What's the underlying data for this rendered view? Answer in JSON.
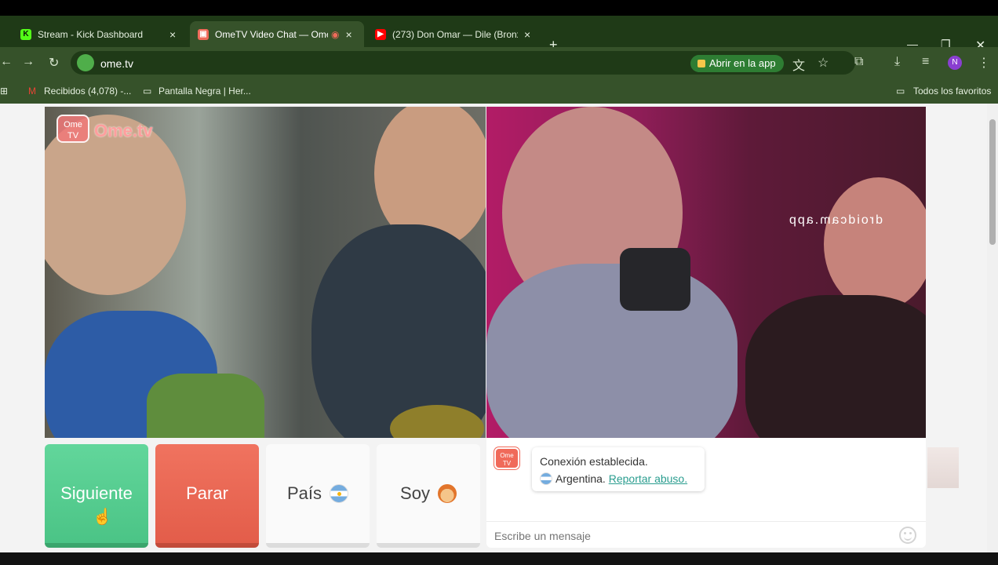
{
  "tabs": [
    {
      "label": "Stream - Kick Dashboard",
      "icon": "kick-icon",
      "active": false
    },
    {
      "label": "OmeTV Video Chat — Ome",
      "icon": "ometv-icon",
      "active": true
    },
    {
      "label": "(273) Don Omar — Dile (Bronx",
      "icon": "youtube-icon",
      "active": false
    }
  ],
  "toolbar": {
    "url": "ome.tv",
    "open_app_label": "Abrir en la app"
  },
  "bookmarks": {
    "items": [
      "Recibidos (4,078) -...",
      "Pantalla Negra | Her..."
    ],
    "all_favorites": "Todos los favoritos"
  },
  "video": {
    "left_watermark": "Ome.tv",
    "watermark_badge": "Ome TV",
    "right_overlay_text": "droidcam.app"
  },
  "controls": {
    "next_label": "Siguiente",
    "stop_label": "Parar",
    "country_label": "País",
    "me_label": "Soy"
  },
  "chat": {
    "logo_text": "Ome TV",
    "status": "Conexión establecida.",
    "country": "Argentina.",
    "report_label": "Reportar abuso.",
    "input_placeholder": "Escribe un mensaje"
  },
  "colors": {
    "tabstrip": "#1f3a17",
    "toolbar": "#36522a",
    "next_button": "#4bc486",
    "stop_button": "#e35d4a",
    "report_link": "#2a9d8f"
  }
}
